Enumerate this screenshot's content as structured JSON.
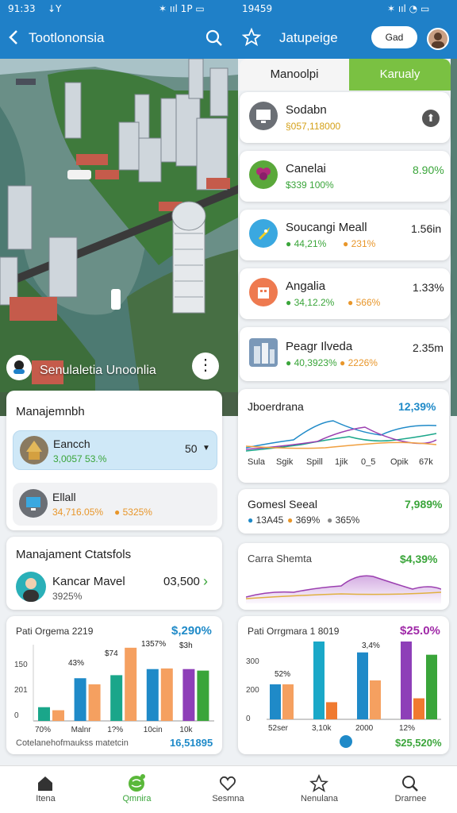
{
  "status_left": {
    "time": "91:33",
    "signal": "↓Y"
  },
  "status_right": {
    "time": "19459"
  },
  "header_left": {
    "title": "Tootlononsia"
  },
  "header_right": {
    "title": "Jatupeige",
    "go_button": "Gad"
  },
  "photo": {
    "caption": "Senulaletia Unoonlia"
  },
  "tabs": [
    {
      "label": "Manoolpi",
      "active": false
    },
    {
      "label": "Karualy",
      "active": true
    }
  ],
  "accent_color": "#7ac142",
  "left_panel": {
    "title": "Manajemnbh",
    "items": [
      {
        "name": "Eancch",
        "sub": "3,0057 53.%",
        "value": "50",
        "highlighted": true
      },
      {
        "name": "Ellall",
        "sub1": "34,716.05%",
        "sub2": "5325%",
        "value": ""
      }
    ]
  },
  "left_panel2": {
    "title": "Manajament Ctatsfols",
    "person": {
      "name": "Kancar Mavel",
      "sub": "3925%",
      "value": "03,500"
    }
  },
  "right_list": [
    {
      "name": "Sodabn",
      "sub1": "§057,118000",
      "sub2": "",
      "value": ""
    },
    {
      "name": "Canelai",
      "sub1": "$339 100%",
      "sub2": "",
      "value": "8.90%"
    },
    {
      "name": "Soucangi Meall",
      "sub1": "44,21%",
      "sub2": "231%",
      "value": "1.56in"
    },
    {
      "name": "Angalia",
      "sub1": "34,12.2%",
      "sub2": "566%",
      "value": "1.33%"
    },
    {
      "name": "Peagr Ilveda",
      "sub1": "40,3923%",
      "sub2": "2226%",
      "value": "2.35m"
    }
  ],
  "line_card": {
    "title": "Jboerdrana",
    "value": "12,39%",
    "labels": [
      "Sula",
      "Sgik",
      "Spill",
      "1jik",
      "0_5",
      "Opik",
      "67k"
    ]
  },
  "stat_card": {
    "title": "Gomesl Seeal",
    "value": "7,989%",
    "stats": [
      "13A45",
      "369%",
      "365%"
    ]
  },
  "area_card": {
    "title": "Carra Shemta",
    "value": "$4,39%"
  },
  "chart_data": [
    {
      "type": "bar",
      "title": "Pati Orgema 2219",
      "headline": "$,290%",
      "categories": [
        "70%",
        "Malnr",
        "1?%",
        "10cin",
        "10k"
      ],
      "series": [
        {
          "values": [
            45,
            140,
            150,
            170,
            170
          ],
          "color": "#1aa68a"
        },
        {
          "values": [
            35,
            120,
            240,
            172,
            165
          ],
          "color": "#f5a060"
        }
      ],
      "data_labels": [
        "43%",
        "$74",
        "1357%",
        "$3h"
      ],
      "yticks": [
        "150",
        "201",
        "0"
      ],
      "footer": "Cotelanehofmaukss matetcin",
      "footer_value": "16,51895"
    },
    {
      "type": "bar",
      "title": "Pati Orrgmara 1 8019",
      "headline": "$25.0%",
      "categories": [
        "52ser",
        "3,10k",
        "2000",
        "12%"
      ],
      "yticks": [
        "300",
        "200",
        "0"
      ],
      "data_labels": [
        "52%",
        "3,4%"
      ],
      "footer_value": "$25,520%"
    }
  ],
  "bottom_nav": [
    {
      "label": "Itena",
      "icon": "home-icon",
      "active": false
    },
    {
      "label": "Qmnira",
      "icon": "globe-icon",
      "active": true
    },
    {
      "label": "Sesmna",
      "icon": "heart-icon",
      "active": false
    },
    {
      "label": "Nenulana",
      "icon": "star-icon",
      "active": false
    },
    {
      "label": "Drarnee",
      "icon": "search-icon",
      "active": false
    }
  ]
}
